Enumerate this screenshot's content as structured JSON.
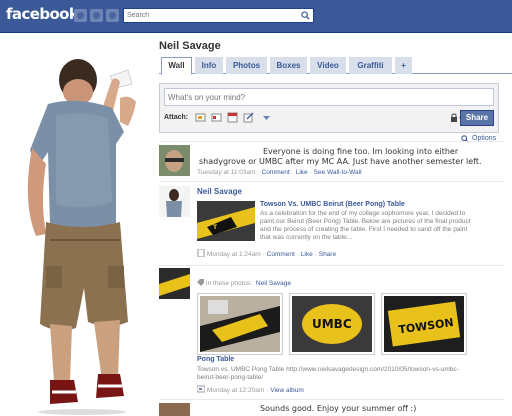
{
  "header": {
    "logo": "facebook",
    "search_placeholder": "Search"
  },
  "profile": {
    "name": "Neil Savage",
    "tabs": [
      {
        "label": "Wall"
      },
      {
        "label": "Info"
      },
      {
        "label": "Photos"
      },
      {
        "label": "Boxes"
      },
      {
        "label": "Video"
      },
      {
        "label": "Graffiti"
      },
      {
        "label": "+"
      }
    ]
  },
  "composer": {
    "placeholder": "What's on your mind?",
    "attach_label": "Attach:",
    "share_label": "Share"
  },
  "options_label": "Options",
  "stories": [
    {
      "text_line1": "Everyone is doing fine too. Im looking into either",
      "text_line2": "shadygrove or UMBC after my MC AA. Just have another semester left.",
      "time": "Tuesday at 11:03am",
      "action_comment": "Comment",
      "action_like": "Like",
      "action_wall": "See Wall-to-Wall"
    },
    {
      "actor": "Neil Savage",
      "link_title": "Towson Vs. UMBC Beirut (Beer Pong) Table",
      "desc1": "As a celebration for the end of my college sophomore year, I decided to",
      "desc2": "paint our Beirut (Beer Pong) Table. Below are pictures of the final product",
      "desc3": "and the process of creating the table. First I needed to sand off the paint",
      "desc4": "that was currently on the table...",
      "time": "Monday at 1:24am",
      "action_comment": "Comment",
      "action_like": "Like",
      "action_share": "Share"
    },
    {
      "in_photos_prefix": "In these photos:",
      "in_photos_name": "Neil Savage",
      "album_title": "Pong Table",
      "album_desc1": "Towson vs. UMBC Pong Table http://www.neilsavagedesign.com/2010/05/towson-vs-umbc-",
      "album_desc2": "beirut-beer-pong-table/",
      "time": "Monday at 12:20am",
      "action_album": "View album"
    },
    {
      "text_line1": "Sounds good. Enjoy your summer off :)"
    }
  ],
  "colors": {
    "brand": "#3b5998",
    "tab_bg": "#d8dfea",
    "share": "#5b74a8"
  }
}
